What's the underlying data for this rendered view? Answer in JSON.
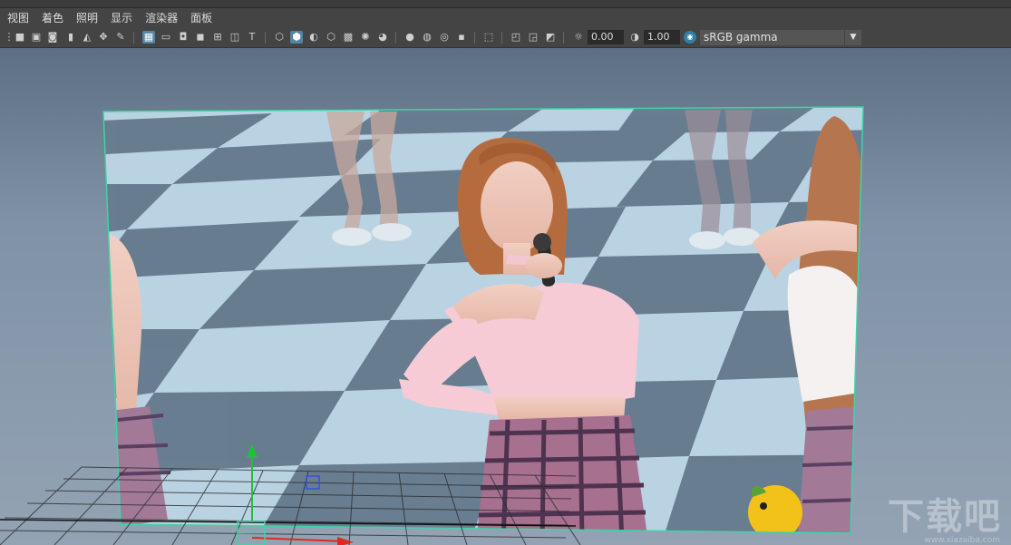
{
  "menu": [
    "视图",
    "着色",
    "照明",
    "显示",
    "渲染器",
    "面板"
  ],
  "toolbar": {
    "exposure_value": "0.00",
    "gamma_value": "1.00",
    "color_space": "sRGB gamma"
  },
  "icons": {
    "camera": "camera-icon",
    "grid": "grid-icon",
    "wireframe_cube": "wireframe-cube-icon",
    "shaded_cube": "shaded-cube-icon",
    "light": "light-icon",
    "isolate": "isolate-select-icon",
    "exposure": "exposure-icon",
    "gamma": "gamma-icon",
    "color_management": "color-management-icon",
    "dropdown": "dropdown-arrow-icon"
  },
  "colors": {
    "active_button": "#5285a6",
    "viewport_top": "#5d6f83",
    "viewport_bottom": "#93a3b4",
    "selection_outline": "#3fd4a6",
    "move_y_axis": "#22c03a",
    "move_x_axis": "#e0281f"
  },
  "watermark": {
    "text": "下载吧",
    "url": "www.xiazaiba.com"
  }
}
